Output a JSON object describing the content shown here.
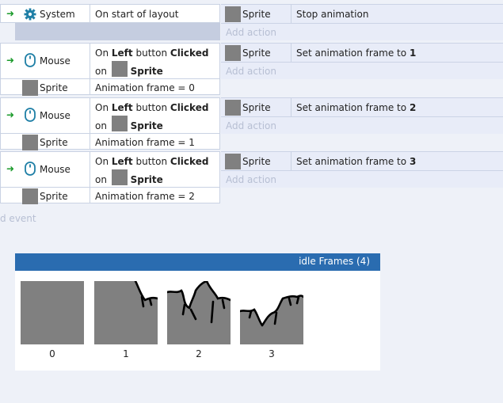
{
  "events": [
    {
      "object": "System",
      "icon": "gear-icon",
      "condition": "On start of layout",
      "action_object": "Sprite",
      "action": "Stop animation",
      "add_action": "Add action"
    },
    {
      "object": "Mouse",
      "icon": "mouse-icon",
      "cond_on": "On",
      "cond_button": "Left",
      "cond_mid": "button",
      "cond_clicked": "Clicked",
      "cond_on2": "on",
      "cond_target": "Sprite",
      "sub_object": "Sprite",
      "sub_condition": "Animation frame = 0",
      "action_object": "Sprite",
      "action_prefix": "Set animation frame to",
      "action_value": "1",
      "add_action": "Add action"
    },
    {
      "object": "Mouse",
      "icon": "mouse-icon",
      "cond_on": "On",
      "cond_button": "Left",
      "cond_mid": "button",
      "cond_clicked": "Clicked",
      "cond_on2": "on",
      "cond_target": "Sprite",
      "sub_object": "Sprite",
      "sub_condition": "Animation frame = 1",
      "action_object": "Sprite",
      "action_prefix": "Set animation frame to",
      "action_value": "2",
      "add_action": "Add action"
    },
    {
      "object": "Mouse",
      "icon": "mouse-icon",
      "cond_on": "On",
      "cond_button": "Left",
      "cond_mid": "button",
      "cond_clicked": "Clicked",
      "cond_on2": "on",
      "cond_target": "Sprite",
      "sub_object": "Sprite",
      "sub_condition": "Animation frame = 2",
      "action_object": "Sprite",
      "action_prefix": "Set animation frame to",
      "action_value": "3",
      "add_action": "Add action"
    }
  ],
  "add_event": "d event",
  "frames_panel": {
    "title": "idle Frames (4)",
    "frames": [
      "0",
      "1",
      "2",
      "3"
    ]
  },
  "colors": {
    "header": "#2a6cb0",
    "swatch": "#808080",
    "arrow": "#1a9a2a"
  }
}
